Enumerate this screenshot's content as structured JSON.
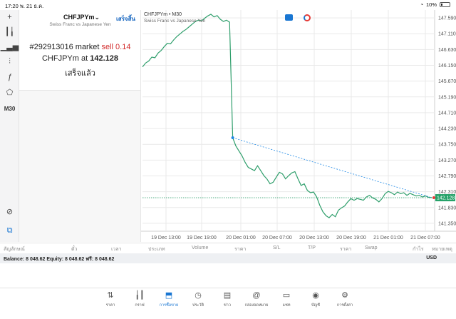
{
  "status": {
    "time": "17:20",
    "date": "พ. 21 ธ.ค.",
    "battery": "10%"
  },
  "toolbar": {
    "timeframe": "M30",
    "items": [
      "crosshair-icon",
      "candles-icon",
      "bar-chart-icon",
      "indicators-icon",
      "function-icon",
      "objects-icon"
    ]
  },
  "order": {
    "symbol": "CHFJPYm",
    "done_link": "เสร็จสิ้น",
    "description": "Swiss Franc vs Japanese Yen",
    "ticket": "#292913016",
    "order_word": "market",
    "side_lot": "sell 0.14",
    "at_word": "at",
    "price": "142.128",
    "status": "เสร็จแล้ว"
  },
  "chart_header": {
    "title": "CHFJPYm • M30",
    "subtitle": "Swiss Franc vs Japanese Yen"
  },
  "chart_data": {
    "type": "line",
    "series": [
      {
        "values": [
          146.1,
          146.22,
          146.28,
          146.4,
          146.38,
          146.52,
          146.6,
          146.72,
          146.82,
          146.8,
          146.92,
          147.02,
          147.1,
          147.18,
          147.24,
          147.32,
          147.4,
          147.48,
          147.52,
          147.5,
          147.58,
          147.65,
          147.7,
          147.62,
          147.66,
          147.55,
          147.48,
          147.52,
          147.46,
          143.95,
          143.7,
          143.55,
          143.4,
          143.2,
          143.05,
          143.0,
          142.95,
          143.1,
          142.95,
          142.8,
          142.7,
          142.55,
          142.6,
          142.75,
          142.9,
          142.85,
          142.7,
          142.8,
          142.88,
          142.92,
          142.7,
          142.5,
          142.55,
          142.35,
          142.28,
          142.3,
          142.15,
          141.9,
          141.7,
          141.58,
          141.52,
          141.62,
          141.55,
          141.75,
          141.82,
          141.88,
          142.0,
          142.1,
          142.05,
          142.1,
          142.08,
          142.05,
          142.15,
          142.2,
          142.12,
          142.08,
          142.0,
          142.1,
          142.25,
          142.32,
          142.28,
          142.22,
          142.3,
          142.25,
          142.28,
          142.2,
          142.26,
          142.22,
          142.18,
          142.2,
          142.15,
          142.18,
          142.14,
          142.13
        ]
      }
    ],
    "y_ticks": [
      "147.590",
      "147.110",
      "146.630",
      "146.150",
      "145.670",
      "145.190",
      "144.710",
      "144.230",
      "143.750",
      "143.270",
      "142.790",
      "142.310",
      "141.830",
      "141.350"
    ],
    "x_ticks": [
      "19 Dec 13:00",
      "19 Dec 19:00",
      "20 Dec 01:00",
      "20 Dec 07:00",
      "20 Dec 13:00",
      "20 Dec 19:00",
      "21 Dec 01:00",
      "21 Dec 07:00"
    ],
    "ylim": [
      141.11,
      147.83
    ],
    "current_price": "142.128",
    "current_value": 142.128,
    "trade_line": {
      "from_index": 29,
      "from_value": 143.95,
      "to_index": 93,
      "to_value": 142.13
    },
    "colors": {
      "line": "#2e9e6b",
      "price_line": "#2e9e6b",
      "trade": "#1e88e5",
      "close_marker": "#e53935",
      "price_label_bg": "#26a269",
      "grid": "#e9e9e9"
    },
    "grid": true
  },
  "table_header": [
    "สัญลักษณ์",
    "ตั๋ว",
    "เวลา",
    "ประเภท",
    "Volume",
    "ราคา",
    "S/L",
    "T/P",
    "ราคา",
    "Swap",
    "กำไร",
    "หมายเหตุ"
  ],
  "balance": {
    "text": "Balance: 8 048.62 Equity: 8 048.62 ฟรี: 8 048.62",
    "currency": "USD"
  },
  "tabs": [
    {
      "label": "ราคา",
      "icon": "quotes-icon"
    },
    {
      "label": "กราฟ",
      "icon": "chart-icon"
    },
    {
      "label": "การซื้อขาย",
      "icon": "trade-icon",
      "active": true
    },
    {
      "label": "ประวัติ",
      "icon": "history-icon"
    },
    {
      "label": "ข่าว",
      "icon": "news-icon"
    },
    {
      "label": "กล่องจดหมาย",
      "icon": "mailbox-icon"
    },
    {
      "label": "แชท",
      "icon": "chat-icon"
    },
    {
      "label": "บัญชี",
      "icon": "account-icon"
    },
    {
      "label": "การตั้งค่า",
      "icon": "settings-icon"
    }
  ]
}
